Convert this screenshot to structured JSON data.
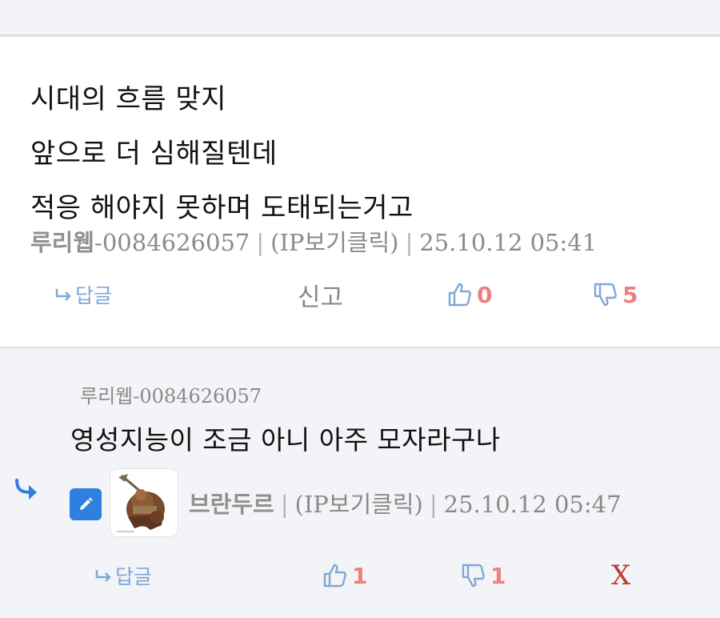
{
  "comment1": {
    "lines": [
      "시대의 흐름 맞지",
      "앞으로 더 심해질텐데",
      "적응 해야지 못하며 도태되는거고"
    ],
    "nickname": "루리웹",
    "user_id": "-0084626057",
    "ip_label": "(IP보기클릭)",
    "timestamp": "25.10.12 05:41",
    "reply_label": "답글",
    "report_label": "신고",
    "upvotes": "0",
    "downvotes": "5"
  },
  "comment2": {
    "reply_to": {
      "nickname": "루리웹",
      "user_id": "-0084626057"
    },
    "text": "영성지능이 조금 아니 아주 모자라구나",
    "nickname": "브란두르",
    "ip_label": "(IP보기클릭)",
    "timestamp": "25.10.12 05:47",
    "reply_label": "답글",
    "upvotes": "1",
    "downvotes": "1",
    "delete_label": "X"
  },
  "separator": "|",
  "icons": {
    "reply_arrow": "reply-arrow-icon",
    "thumbs_up": "thumbs-up-icon",
    "thumbs_down": "thumbs-down-icon",
    "reply_indicator": "reply-indicator-icon",
    "edit": "pencil-edit-icon"
  },
  "colors": {
    "reply_link": "#7fa7d8",
    "vote_icon": "#7fa7d8",
    "vote_count": "#ef7f7f",
    "delete": "#c0392b",
    "edit_badge": "#2f7fe0",
    "reply_indicator": "#2f7fe0"
  }
}
